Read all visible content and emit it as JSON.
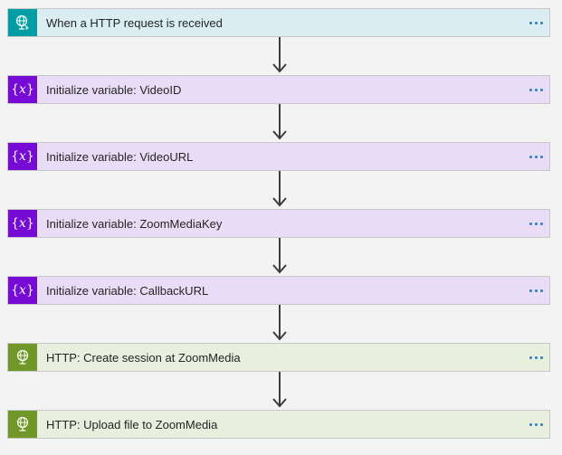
{
  "steps": [
    {
      "kind": "trigger",
      "icon": "http-request-globe-icon",
      "label": "When a HTTP request is received"
    },
    {
      "kind": "variable",
      "icon": "variable-icon",
      "label": "Initialize variable: VideoID"
    },
    {
      "kind": "variable",
      "icon": "variable-icon",
      "label": "Initialize variable: VideoURL"
    },
    {
      "kind": "variable",
      "icon": "variable-icon",
      "label": "Initialize variable: ZoomMediaKey"
    },
    {
      "kind": "variable",
      "icon": "variable-icon",
      "label": "Initialize variable: CallbackURL"
    },
    {
      "kind": "http",
      "icon": "http-globe-icon",
      "label": "HTTP: Create session at ZoomMedia"
    },
    {
      "kind": "http",
      "icon": "http-globe-icon",
      "label": "HTTP: Upload file to ZoomMedia"
    }
  ],
  "variable_glyph": {
    "open": "{",
    "x": "x",
    "close": "}"
  },
  "colors": {
    "trigger_icon_bg": "#009da5",
    "trigger_card_bg": "#d9edf2",
    "variable_icon_bg": "#770bd6",
    "variable_card_bg": "#e8dcf6",
    "http_icon_bg": "#709727",
    "http_card_bg": "#e8efde",
    "more_dots": "#2b7bc5",
    "connector": "#3c3c3c"
  }
}
